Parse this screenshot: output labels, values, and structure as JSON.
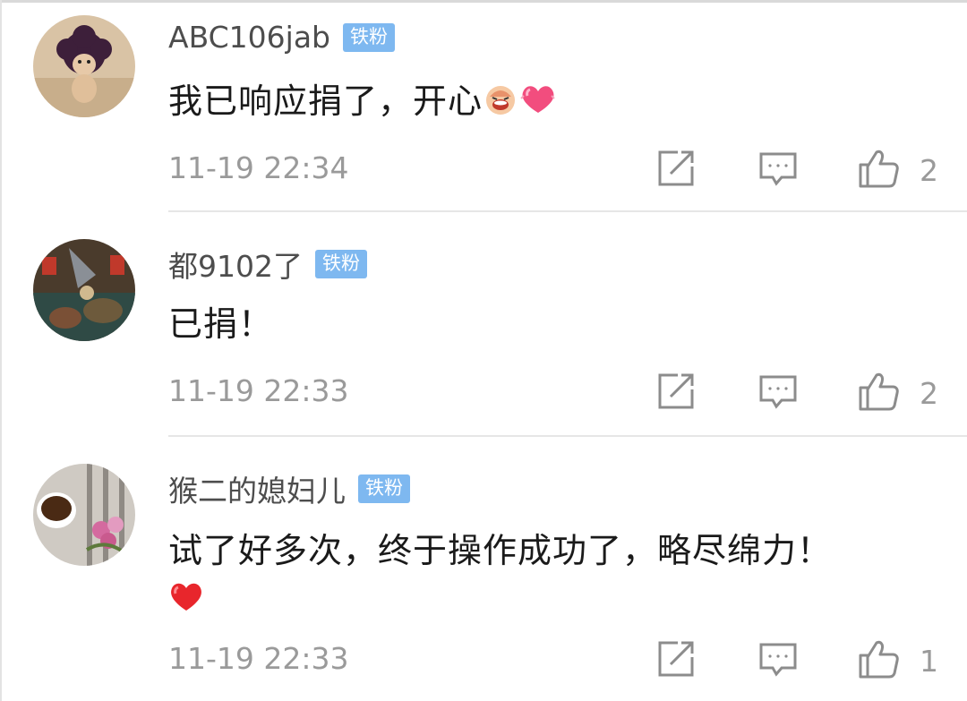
{
  "comments": [
    {
      "username": "ABC106jab",
      "badge": "铁粉",
      "text": "我已响应捐了，开心",
      "emojis": [
        "laughing-face-emoji",
        "heart-emoji"
      ],
      "time": "11-19 22:34",
      "likes": "2"
    },
    {
      "username": "都9102了",
      "badge": "铁粉",
      "text": "已捐！",
      "time": "11-19 22:33",
      "likes": "2"
    },
    {
      "username": "猴二的媳妇儿",
      "badge": "铁粉",
      "text": "试了好多次，终于操作成功了，略尽绵力！",
      "emojis": [
        "red-heart-emoji"
      ],
      "time": "11-19 22:33",
      "likes": "1"
    }
  ],
  "icons": {
    "repost": "repost-icon",
    "reply": "comment-icon",
    "like": "thumbs-up-icon"
  },
  "colors": {
    "badge": "#7eb8f0",
    "meta_text": "#9a9a9a",
    "icon": "#8c8c8c"
  }
}
